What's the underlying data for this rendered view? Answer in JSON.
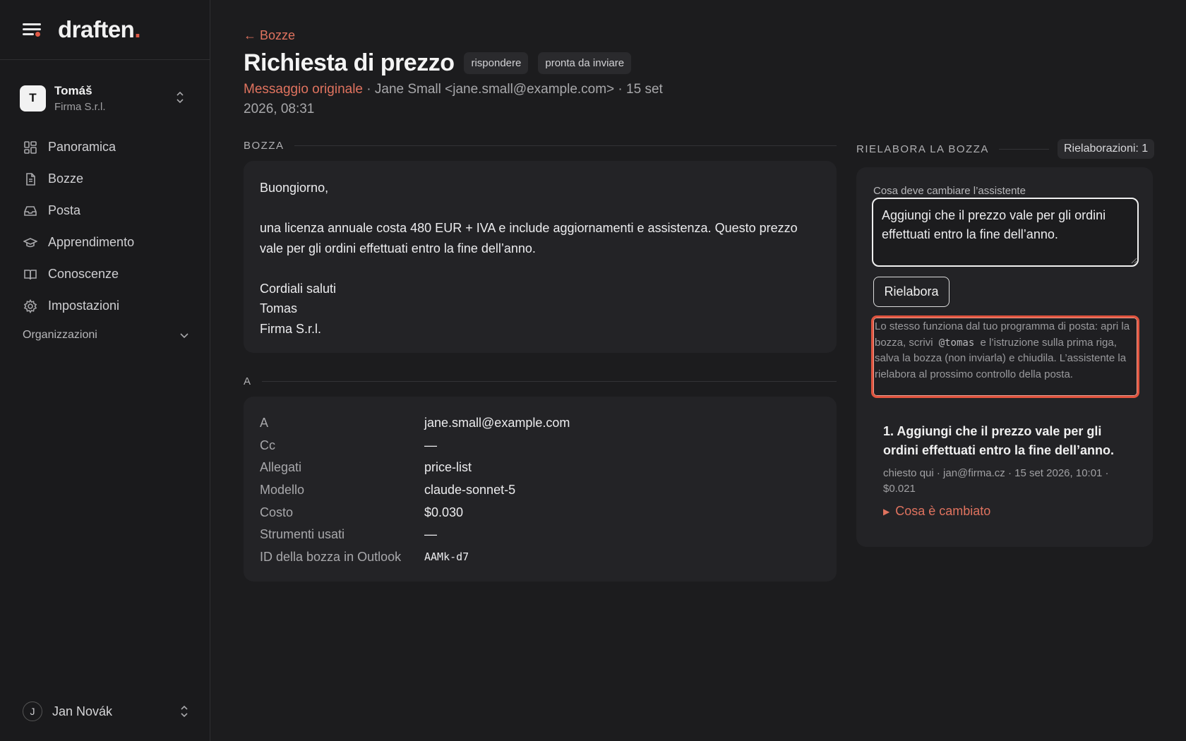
{
  "app": {
    "logo_text": "draften",
    "logo_dot": ".",
    "accent": "#e05a47"
  },
  "account": {
    "initial": "T",
    "name": "Tomáš",
    "org": "Firma S.r.l."
  },
  "sidebar": {
    "items": [
      {
        "label": "Panoramica",
        "icon": "grid-icon"
      },
      {
        "label": "Bozze",
        "icon": "document-icon"
      },
      {
        "label": "Posta",
        "icon": "inbox-icon"
      },
      {
        "label": "Apprendimento",
        "icon": "graduation-cap-icon"
      },
      {
        "label": "Conoscenze",
        "icon": "book-icon"
      },
      {
        "label": "Impostazioni",
        "icon": "gear-icon"
      }
    ],
    "orgs_label": "Organizzazioni"
  },
  "user": {
    "initial": "J",
    "name": "Jan Novák"
  },
  "header": {
    "back": "← Bozze",
    "title": "Richiesta di prezzo",
    "badges": [
      "rispondere",
      "pronta da inviare"
    ],
    "original_link": "Messaggio originale",
    "meta_rest": " · Jane Small <jane.small@example.com> · 15 set 2026, 08:31"
  },
  "draft": {
    "section_label": "BOZZA",
    "greeting": "Buongiorno,",
    "body": "una licenza annuale costa 480 EUR + IVA e include aggiornamenti e assistenza. Questo prezzo vale per gli ordini effettuati entro la fine dell’anno.",
    "closing": "Cordiali saluti",
    "sign_name": "Tomas",
    "sign_org": "Firma S.r.l."
  },
  "details": {
    "section_label": "A",
    "rows": [
      {
        "k": "A",
        "v": "jane.small@example.com"
      },
      {
        "k": "Cc",
        "v": "—"
      },
      {
        "k": "Allegati",
        "v": "price-list"
      },
      {
        "k": "Modello",
        "v": "claude-sonnet-5"
      },
      {
        "k": "Costo",
        "v": "$0.030"
      },
      {
        "k": "Strumenti usati",
        "v": "—"
      },
      {
        "k": "ID della bozza in Outlook",
        "v": "AAMk-d7"
      }
    ]
  },
  "rework": {
    "section_label": "RIELABORA LA BOZZA",
    "count_label": "Rielaborazioni: 1",
    "field_label": "Cosa deve cambiare l’assistente",
    "field_value": "Aggiungi che il prezzo vale per gli ordini effettuati entro la fine dell’anno.",
    "button": "Rielabora",
    "hint_pre": "Lo stesso funziona dal tuo programma di posta: apri la bozza, scrivi",
    "hint_code": "@tomas",
    "hint_post": "e l’istruzione sulla prima riga, salva la bozza (non inviarla) e chiudila. L’assistente la rielabora al prossimo controllo della posta.",
    "history": {
      "title": "1. Aggiungi che il prezzo vale per gli ordini effettuati entro la fine dell’anno.",
      "meta": "chiesto qui · jan@firma.cz · 15 set 2026, 10:01 · $0.021",
      "changes_label": "Cosa è cambiato"
    }
  }
}
